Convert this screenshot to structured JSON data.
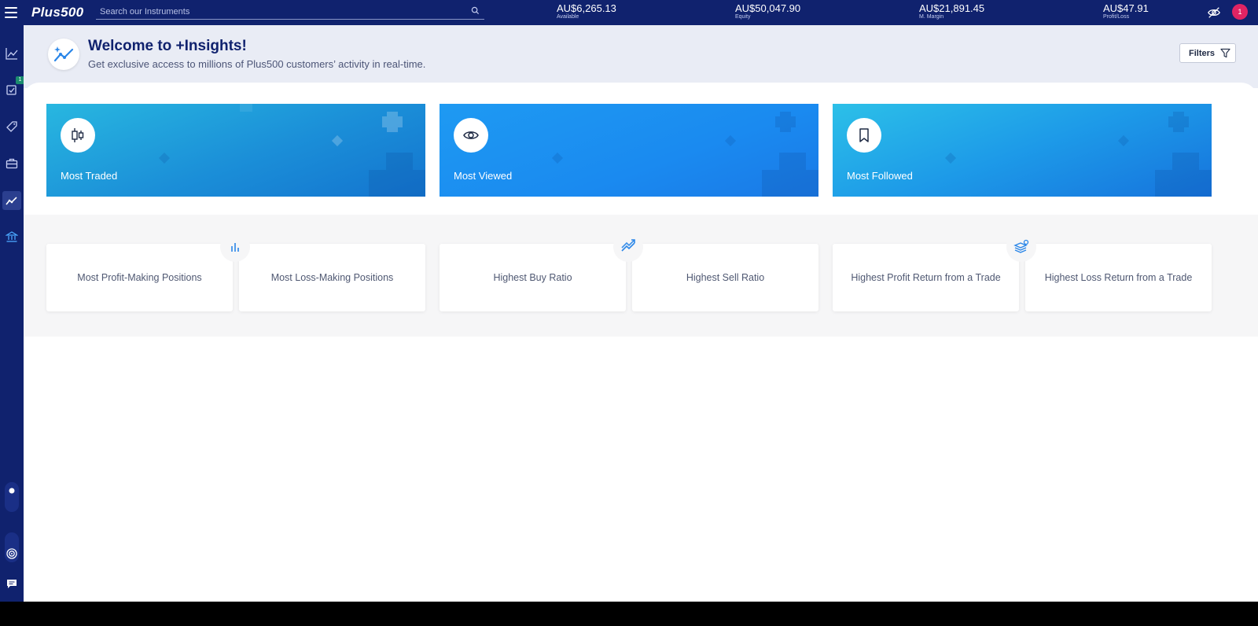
{
  "topbar": {
    "logo": "Plus500",
    "search_placeholder": "Search our Instruments",
    "stats": [
      {
        "value": "AU$6,265.13",
        "label": "Available"
      },
      {
        "value": "AU$50,047.90",
        "label": "Equity"
      },
      {
        "value": "AU$21,891.45",
        "label": "M. Margin"
      },
      {
        "value": "AU$47.91",
        "label": "Profit/Loss"
      }
    ],
    "notification_count": "1"
  },
  "sidebar": {
    "badge": "1",
    "items": [
      "chart-line-icon",
      "watchlist-icon",
      "tag-icon",
      "briefcase-icon",
      "insights-icon",
      "bank-icon"
    ]
  },
  "header": {
    "title": "Welcome to +Insights!",
    "subtitle": "Get exclusive access to millions of Plus500 customers’ activity in real-time.",
    "filters_label": "Filters"
  },
  "hero_cards": [
    {
      "label": "Most Traded",
      "icon": "candlestick-icon"
    },
    {
      "label": "Most Viewed",
      "icon": "eye-icon"
    },
    {
      "label": "Most Followed",
      "icon": "bookmark-icon"
    }
  ],
  "insight_cards": [
    {
      "label": "Most Profit-Making Positions"
    },
    {
      "label": "Most Loss-Making Positions"
    },
    {
      "label": "Highest Buy Ratio"
    },
    {
      "label": "Highest Sell Ratio"
    },
    {
      "label": "Highest Profit Return from a Trade"
    },
    {
      "label": "Highest Loss Return from a Trade"
    }
  ],
  "colors": {
    "navy": "#10226e",
    "header_bg": "#e9ecf5",
    "accent_blue": "#1e9af2",
    "notification": "#e02463"
  }
}
